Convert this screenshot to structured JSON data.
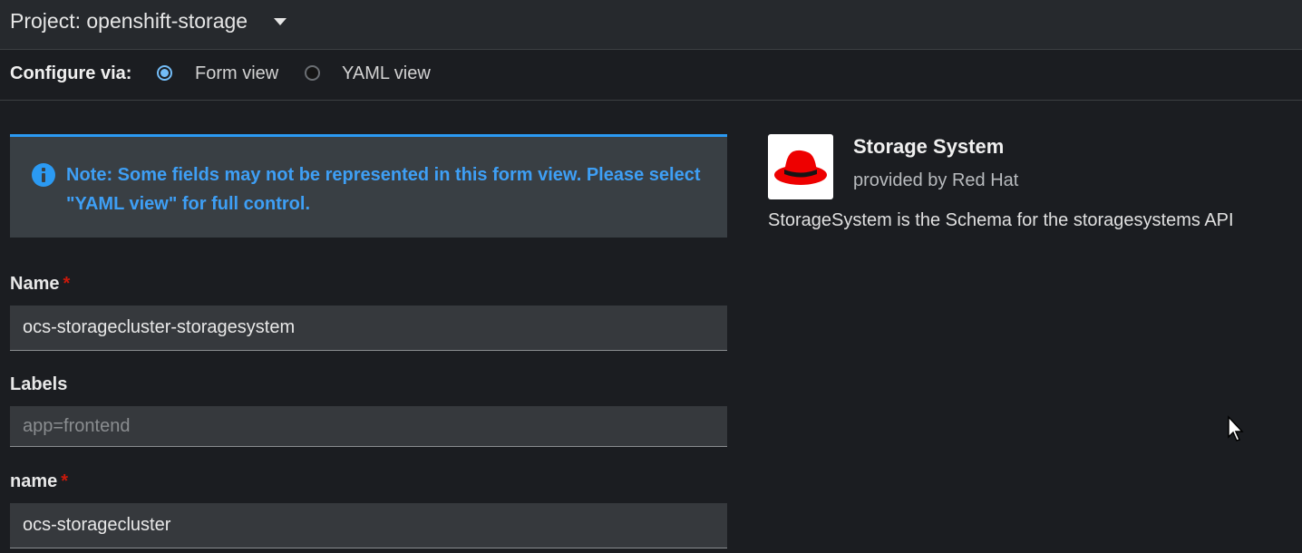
{
  "project": {
    "label": "Project: openshift-storage",
    "caret_icon": "caret-down-icon"
  },
  "configure": {
    "label": "Configure via:",
    "options": [
      {
        "label": "Form view",
        "checked": true
      },
      {
        "label": "YAML view",
        "checked": false
      }
    ]
  },
  "alert": {
    "icon": "info-circle-icon",
    "text": "Note: Some fields may not be represented in this form view. Please select \"YAML view\" for full control.",
    "color": "#2b9af3"
  },
  "form": {
    "name_label": "Name",
    "required_mark": "*",
    "name_value": "ocs-storagecluster-storagesystem",
    "labels_label": "Labels",
    "labels_placeholder": "app=frontend",
    "spec_name_label": "name",
    "spec_name_value": "ocs-storagecluster"
  },
  "provider": {
    "logo_icon": "red-hat-fedora-icon",
    "title": "Storage System",
    "subtitle": "provided by Red Hat",
    "description": "StorageSystem is the Schema for the storagesystems API",
    "brand_color": "#ee0000"
  }
}
